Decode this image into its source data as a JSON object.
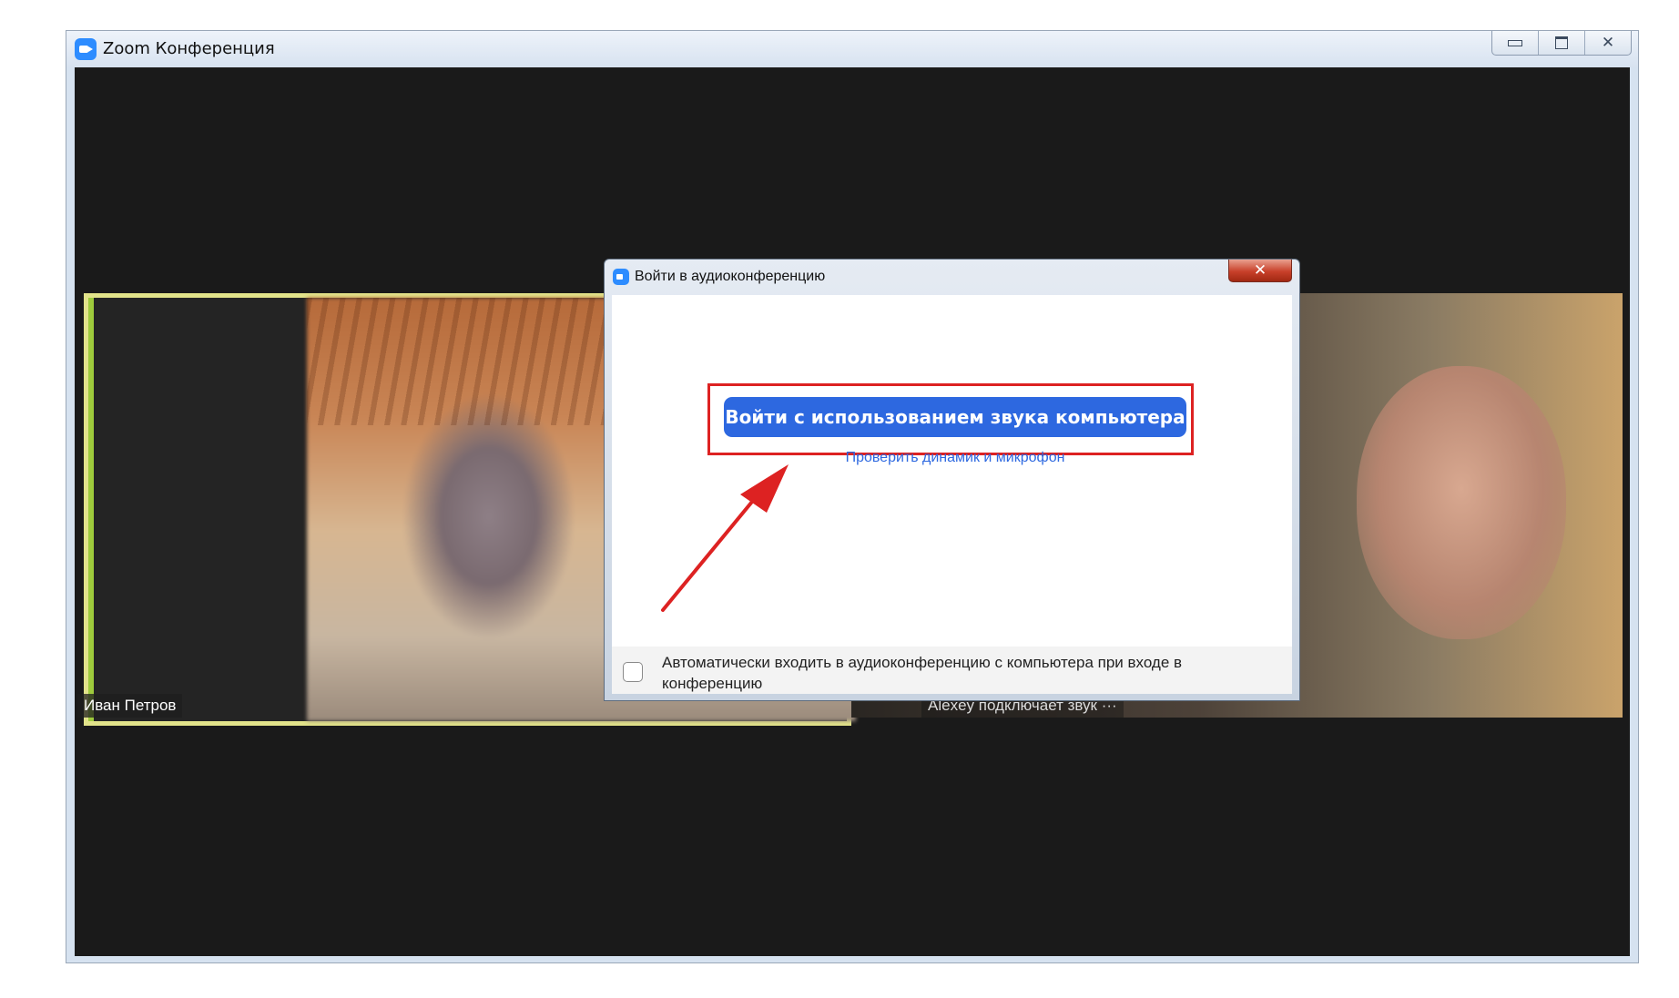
{
  "window": {
    "title": "Zoom Конференция",
    "controls": {
      "minimize": "minimize-icon",
      "maximize": "maximize-icon",
      "close": "✕"
    }
  },
  "participants": [
    {
      "name": "Иван Петров"
    },
    {
      "status": "Alexey подключает звук ···"
    }
  ],
  "dialog": {
    "title": "Войти в аудиоконференцию",
    "close_label": "✕",
    "join_button": "Войти с использованием звука компьютера",
    "test_link": "Проверить динамик и микрофон",
    "auto_join_label": "Автоматически входить в аудиоконференцию с компьютера при входе в конференцию",
    "auto_join_checked": false
  },
  "annotation": {
    "color": "#dd2222"
  },
  "colors": {
    "accent": "#2d68e0",
    "active_speaker": "#e2e38a"
  }
}
